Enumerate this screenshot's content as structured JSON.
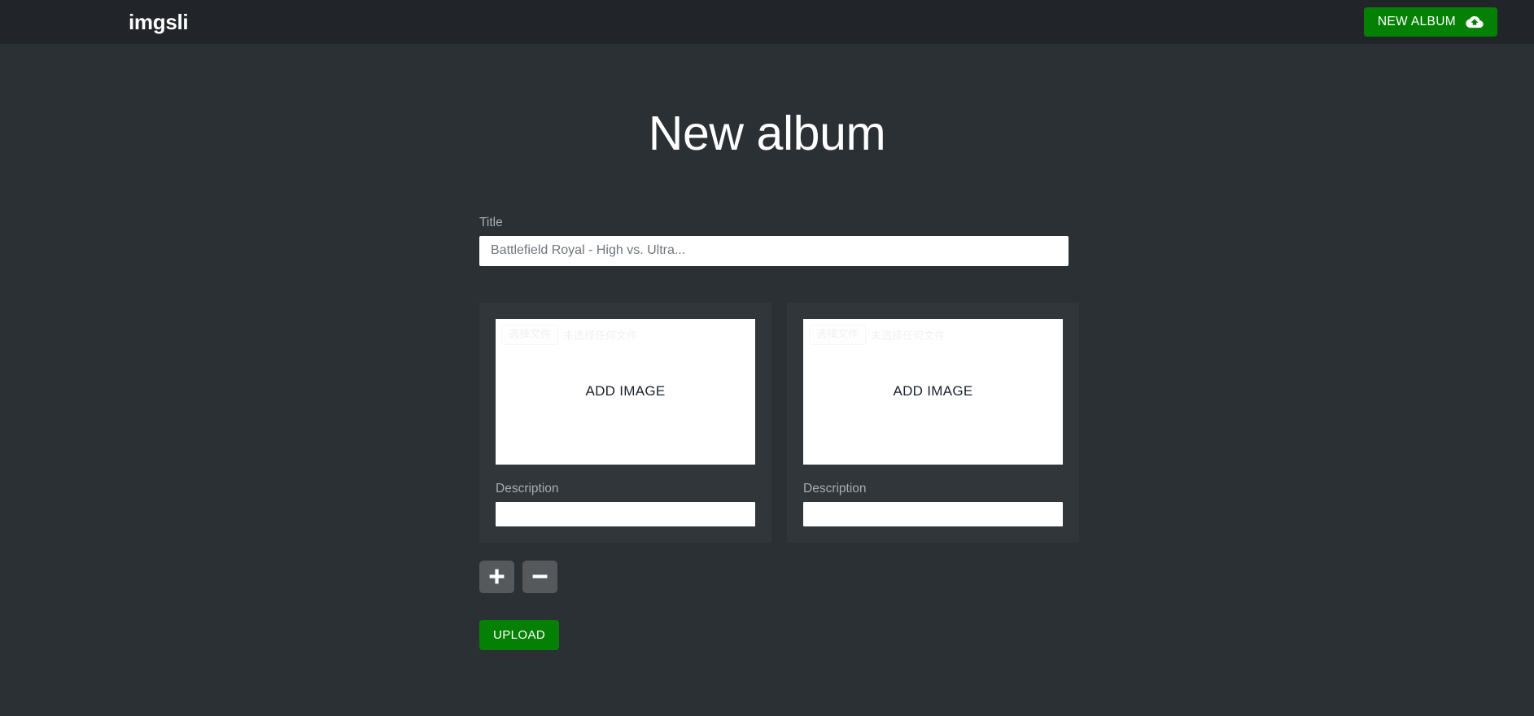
{
  "navbar": {
    "brand": "imgsli",
    "new_album_label": "NEW ALBUM",
    "new_album_icon": "cloud-upload-icon",
    "background_color": "#212529",
    "accent_color": "#048004"
  },
  "page": {
    "title": "New album",
    "background_color": "#2b3035"
  },
  "form": {
    "title_field": {
      "label": "Title",
      "value": "",
      "placeholder": "Battlefield Royal - High vs. Ultra..."
    },
    "cards": [
      {
        "drop_label": "ADD IMAGE",
        "file_button_label": "选择文件",
        "file_status_label": "未选择任何文件",
        "description_label": "Description",
        "description_value": "",
        "description_placeholder": ""
      },
      {
        "drop_label": "ADD IMAGE",
        "file_button_label": "选择文件",
        "file_status_label": "未选择任何文件",
        "description_label": "Description",
        "description_value": "",
        "description_placeholder": ""
      }
    ],
    "add_slide_icon": "plus-icon",
    "remove_slide_icon": "minus-icon",
    "upload_label": "UPLOAD"
  }
}
